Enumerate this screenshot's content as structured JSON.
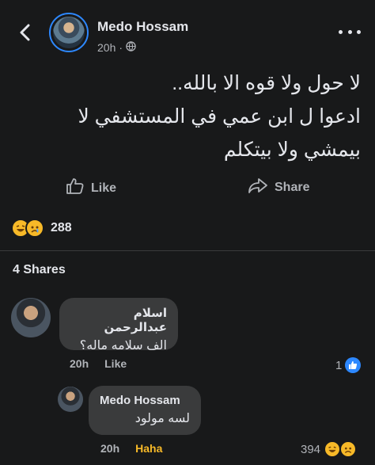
{
  "header": {
    "author": "Medo Hossam",
    "time": "20h",
    "icons": {
      "back": "back-arrow-icon",
      "privacy": "globe-icon",
      "more": "more-dots-icon"
    }
  },
  "post": {
    "lines": [
      "لا حول ولا قوه الا بالله..",
      "ادعوا ل ابن عمي في المستشفي لا",
      "بيمشي ولا بيتكلم"
    ]
  },
  "actions": {
    "like": "Like",
    "share": "Share"
  },
  "reactions": {
    "count": "288"
  },
  "shares": {
    "label": "4 Shares"
  },
  "comments": [
    {
      "author": "اسلام عبدالرحمن",
      "text": "الف سلامه ماله؟",
      "time": "20h",
      "action": "Like",
      "likes": "1"
    },
    {
      "author": "Medo Hossam",
      "text": "لسه مولود",
      "time": "20h",
      "action": "Haha",
      "reactions": "394"
    }
  ],
  "colors": {
    "background": "#18191a",
    "bubble": "#3a3b3c",
    "accent": "#2d88ff",
    "haha": "#f7b928"
  }
}
